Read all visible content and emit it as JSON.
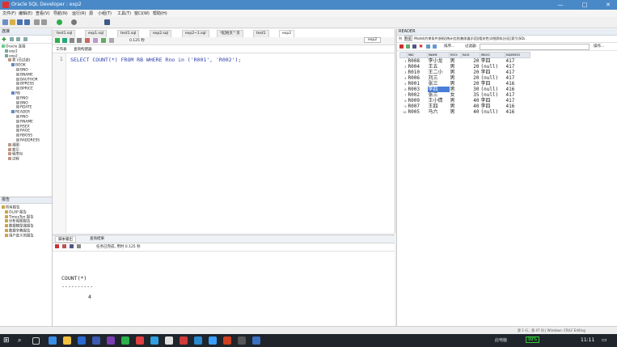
{
  "window": {
    "title": "Oracle SQL Developer : exp2",
    "min": "—",
    "max": "□",
    "close": "✕"
  },
  "menu": [
    "文件(F)",
    "编辑(E)",
    "查看(V)",
    "导航(N)",
    "运行(R)",
    "源",
    "小组(T)",
    "工具(T)",
    "窗口(W)",
    "帮助(H)"
  ],
  "connections": {
    "header": "连接",
    "items": [
      "Oracle 连接",
      "exp1",
      "exp2",
      "表 (已过滤)",
      "BOOK",
      "BNO",
      "BNAME",
      "BAUTHOR",
      "BPRESS",
      "BPRICE",
      "RB",
      "RNO",
      "BNO",
      "RDATE",
      "READER",
      "RNO",
      "RNAME",
      "RSEX",
      "RAGE",
      "RBOSS",
      "RADDRESS",
      "视图",
      "索引",
      "程序包",
      "过程"
    ]
  },
  "reports": {
    "header": "报告",
    "items": [
      "所有报告",
      "OLAP 报告",
      "TimesTen 报告",
      "分析视图报告",
      "数据模型器报告",
      "数据字典报告",
      "用户定义的报告"
    ]
  },
  "editor_tabs": [
    "test1.sql",
    "exp1.sql",
    "test1.sql",
    "exp2.sql",
    "exp2~1.sql",
    "*起始页™页",
    "test1",
    "exp2"
  ],
  "editor": {
    "timing": "0.125 秒",
    "subtabs": [
      "工作表",
      "查询构建器"
    ],
    "line_no": "1",
    "sql": "SELECT COUNT(*) FROM RB WHERE Rno in ('R001', 'R002');",
    "conn_label": "exp2"
  },
  "output": {
    "tabs": [
      "脚本输出",
      "查询结果"
    ],
    "status": "任务已完成, 用时 0.125 秒",
    "col": "COUNT(*)",
    "sep": "----------",
    "val": "4"
  },
  "reader": {
    "title": "READER",
    "tabs": [
      "列",
      "数据",
      "Model",
      "约束条件",
      "授权",
      "统计信息",
      "触发器",
      "闪回",
      "相关性",
      "详细资料",
      "分区",
      "索引",
      "SQL"
    ],
    "sort": "排序...",
    "filter": "过滤器:",
    "ops": "操作...",
    "columns": [
      "RNO",
      "RNAME",
      "RSEX",
      "RAGE",
      "RBOSS",
      "RADDRESS"
    ],
    "rows": [
      [
        "1",
        "R008",
        "李小龙",
        "男",
        "20",
        "李四",
        "417"
      ],
      [
        "2",
        "R004",
        "王五",
        "男",
        "20",
        "(null)",
        "417"
      ],
      [
        "3",
        "R010",
        "王二小",
        "男",
        "20",
        "李四",
        "417"
      ],
      [
        "4",
        "R006",
        "刘三",
        "男",
        "20",
        "(null)",
        "417"
      ],
      [
        "5",
        "R001",
        "张三",
        "男",
        "20",
        "李四",
        "416"
      ],
      [
        "6",
        "R003",
        "李四",
        "男",
        "30",
        "(null)",
        "416"
      ],
      [
        "7",
        "R002",
        "张三",
        "女",
        "35",
        "(null)",
        "417"
      ],
      [
        "8",
        "R009",
        "王小倩",
        "男",
        "40",
        "李四",
        "417"
      ],
      [
        "9",
        "R007",
        "王四",
        "男",
        "40",
        "李四",
        "416"
      ],
      [
        "10",
        "R005",
        "马六",
        "男",
        "40",
        "(null)",
        "416"
      ]
    ]
  },
  "statusbar": {
    "right": "第 1 行，第 47 列 | Windows: CR/LF Editing"
  },
  "taskbar": {
    "time": "11:11",
    "battery": "99%",
    "lang": "此电脑"
  }
}
